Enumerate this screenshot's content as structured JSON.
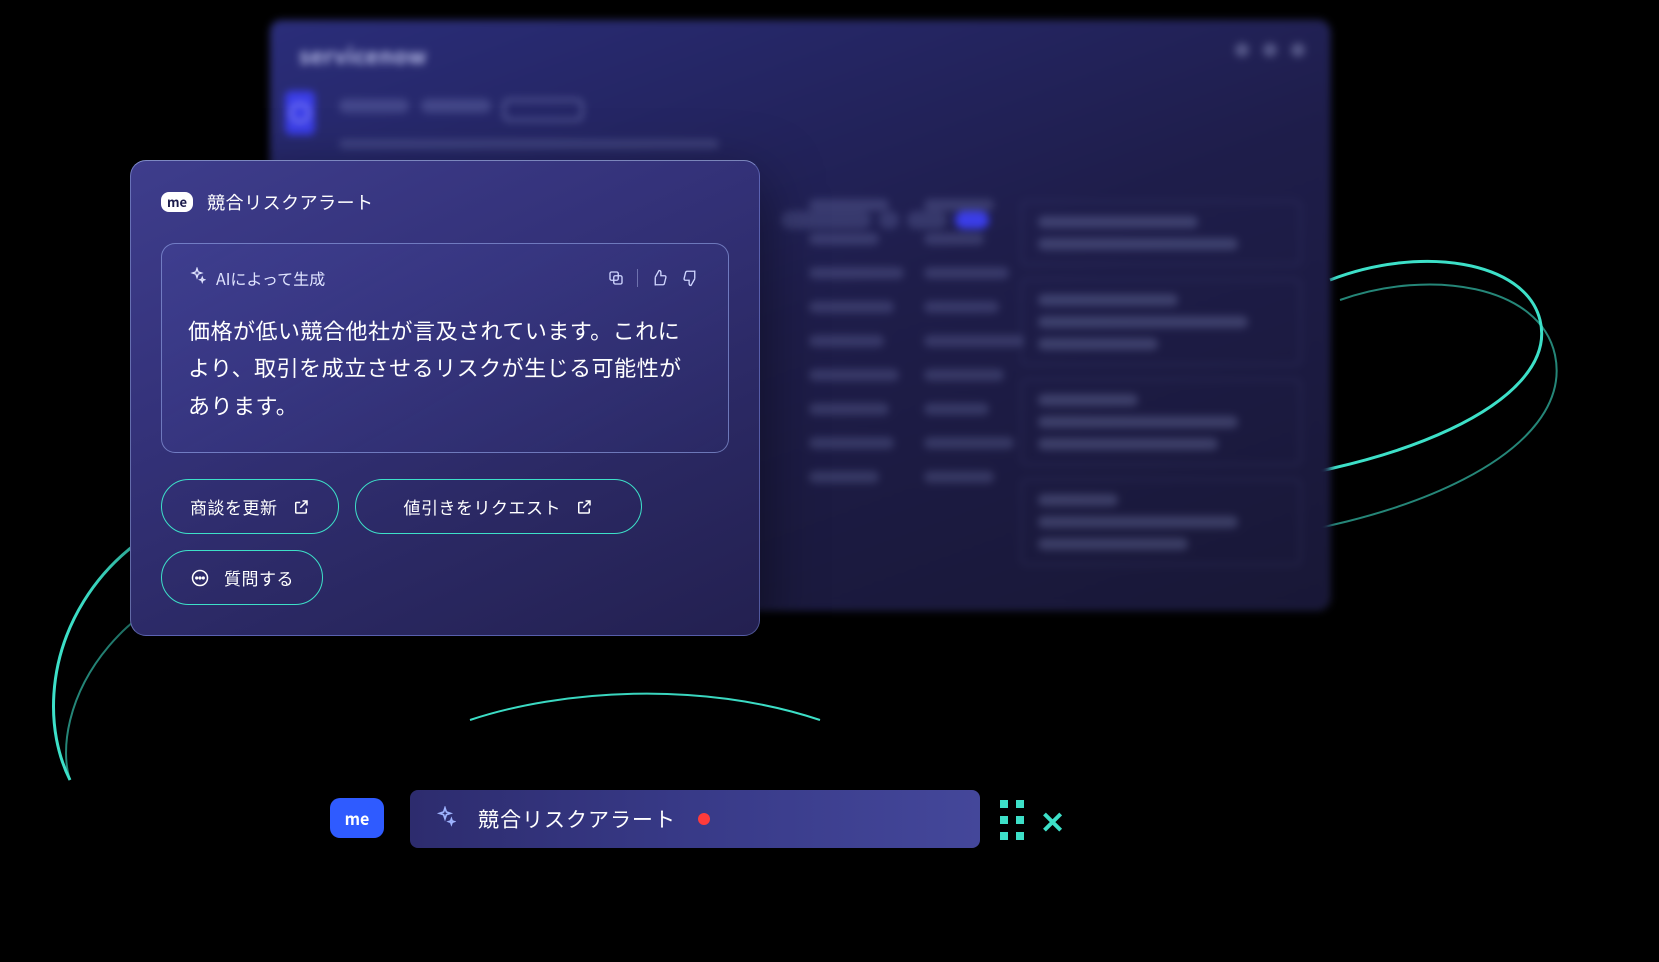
{
  "bg": {
    "brand": "servicenow"
  },
  "card": {
    "badge": "me",
    "title": "競合リスクアラート",
    "ai_label": "AIによって生成",
    "body": "価格が低い競合他社が言及されています。これにより、取引を成立させるリスクが生じる可能性があります。",
    "actions": {
      "update": "商談を更新",
      "discount": "値引きをリクエスト",
      "ask": "質問する"
    }
  },
  "notif": {
    "badge": "me",
    "title": "競合リスクアラート"
  },
  "colors": {
    "teal": "#3de0c8",
    "accent": "#2f5bff"
  }
}
